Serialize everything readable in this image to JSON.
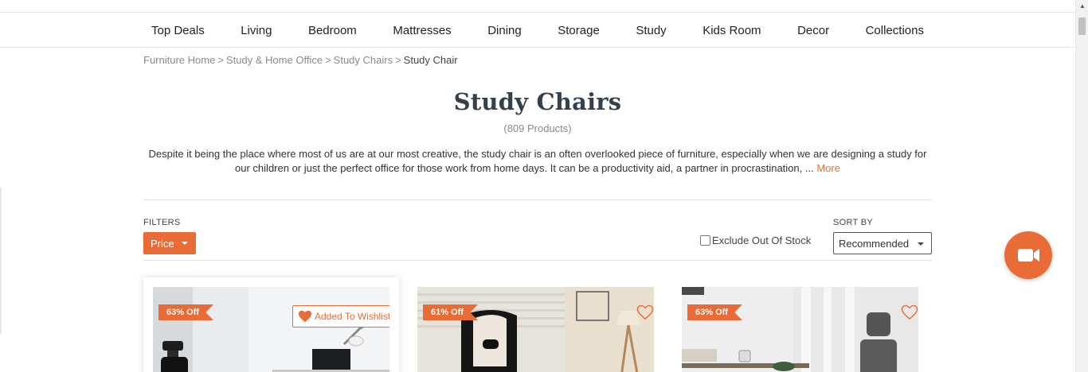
{
  "nav": {
    "items": [
      "Top Deals",
      "Living",
      "Bedroom",
      "Mattresses",
      "Dining",
      "Storage",
      "Study",
      "Kids Room",
      "Decor",
      "Collections"
    ]
  },
  "breadcrumb": {
    "items": [
      "Furniture Home",
      "Study & Home Office",
      "Study Chairs"
    ],
    "separator": ">",
    "current": "Study Chair"
  },
  "page": {
    "title": "Study Chairs",
    "count": "(809 Products)",
    "description": "Despite it being the place where most of us are at our most creative, the study chair is an often overlooked piece of furniture, especially when we are designing a study for our children or just the perfect office for those work from home days. It can be a productivity aid, a partner in procrastination, ...",
    "more_label": "More"
  },
  "filters": {
    "label": "FILTERS",
    "price_label": "Price",
    "exclude_label": "Exclude Out Of Stock",
    "exclude_checked": false
  },
  "sort": {
    "label": "SORT BY",
    "selected": "Recommended"
  },
  "products": [
    {
      "discount": "63% Off",
      "wishlist_label": "Added To Wishlist",
      "wishlisted": true,
      "image": "white office room with black mesh chair and desk lamp"
    },
    {
      "discount": "61% Off",
      "wishlisted": false,
      "image": "white and black gaming chair beside wooden lamp"
    },
    {
      "discount": "63% Off",
      "wishlisted": false,
      "image": "grey mesh chair by window with desk and books"
    }
  ],
  "icons": {
    "heart_filled": "heart-filled-icon",
    "heart_outline": "heart-outline-icon",
    "video": "video-camera-icon",
    "caret": "caret-down-icon"
  },
  "colors": {
    "accent": "#e96b36",
    "title": "#34404b",
    "muted": "#8a8a8a"
  }
}
